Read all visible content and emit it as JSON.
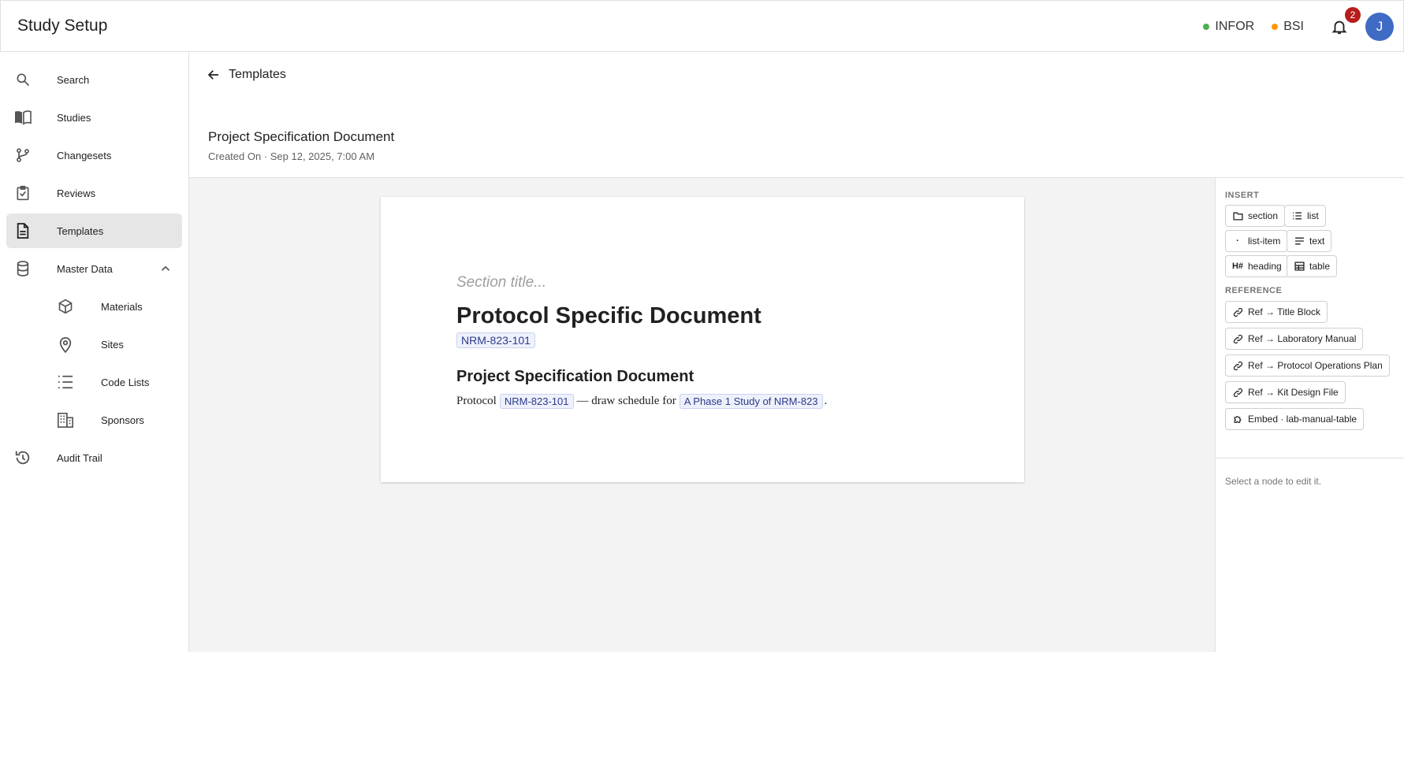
{
  "app": {
    "title": "Study Setup"
  },
  "topbar": {
    "env": [
      {
        "label": "INFOR",
        "color": "#4caf50"
      },
      {
        "label": "BSI",
        "color": "#ff9800"
      }
    ],
    "notifications": "2",
    "avatar": "J"
  },
  "sidebar": {
    "items": [
      {
        "label": "Search",
        "icon": "search-icon"
      },
      {
        "label": "Studies",
        "icon": "book-icon"
      },
      {
        "label": "Changesets",
        "icon": "branch-icon"
      },
      {
        "label": "Reviews",
        "icon": "clipboard-check-icon"
      },
      {
        "label": "Templates",
        "icon": "document-icon",
        "active": true
      },
      {
        "label": "Master Data",
        "icon": "database-icon",
        "expanded": true
      },
      {
        "label": "Materials",
        "icon": "cube-icon"
      },
      {
        "label": "Sites",
        "icon": "map-pin-icon"
      },
      {
        "label": "Code Lists",
        "icon": "list-icon"
      },
      {
        "label": "Sponsors",
        "icon": "building-icon"
      },
      {
        "label": "Audit Trail",
        "icon": "history-icon"
      }
    ]
  },
  "header": {
    "back_label": "Templates",
    "doc_title": "Project Specification Document",
    "meta": "Created On · Sep 12, 2025, 7:00 AM"
  },
  "doc": {
    "section_placeholder": "Section title...",
    "heading1": "Protocol Specific Document",
    "protocol_chip": "NRM-823-101",
    "heading2": "Project Specification Document",
    "para_prefix": "Protocol",
    "para_chip1": "NRM-823-101",
    "para_middle": "— draw schedule for",
    "para_chip2": "A Phase 1 Study of NRM-823",
    "para_suffix": "."
  },
  "panel": {
    "insert_label": "INSERT",
    "insert": [
      {
        "label": "section",
        "icon": "folder-icon"
      },
      {
        "label": "list",
        "icon": "list-icon"
      },
      {
        "label": "list-item",
        "icon": "bullet-icon"
      },
      {
        "label": "text",
        "icon": "text-lines-icon"
      },
      {
        "label": "heading",
        "icon": "heading-icon",
        "glyph": "H#"
      },
      {
        "label": "table",
        "icon": "table-icon"
      }
    ],
    "reference_label": "REFERENCE",
    "references": [
      {
        "label": "Ref → Title Block",
        "icon": "link-icon"
      },
      {
        "label": "Ref → Laboratory Manual",
        "icon": "link-icon"
      },
      {
        "label": "Ref → Protocol Operations Plan",
        "icon": "link-icon"
      },
      {
        "label": "Ref → Kit Design File",
        "icon": "link-icon"
      },
      {
        "label": "Embed · lab-manual-table",
        "icon": "puzzle-icon"
      }
    ],
    "hint": "Select a node to edit it."
  }
}
